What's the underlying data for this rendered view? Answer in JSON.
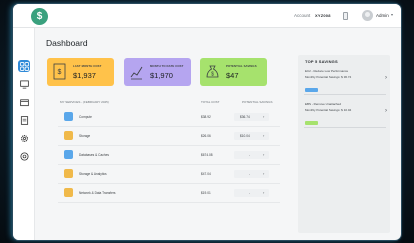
{
  "header": {
    "logo_text": "$",
    "account_label": "Account",
    "account_value": "XYZ008",
    "user_name": "Admin",
    "user_caret": "▾"
  },
  "sidebar": {
    "items": [
      {
        "icon": "grid-icon",
        "active": true
      },
      {
        "icon": "monitor-icon",
        "active": false
      },
      {
        "icon": "wallet-icon",
        "active": false
      },
      {
        "icon": "document-icon",
        "active": false
      },
      {
        "icon": "gear-icon",
        "active": false
      },
      {
        "icon": "globe-icon",
        "active": false
      }
    ]
  },
  "page": {
    "title": "Dashboard"
  },
  "cards": [
    {
      "label": "LAST MONTH COST",
      "value": "$1,937",
      "color": "#ffc24a"
    },
    {
      "label": "MONTH TO DATE COST",
      "value": "$1,970",
      "color": "#b5a5f0"
    },
    {
      "label": "POTENTIAL SAVINGS",
      "value": "$47",
      "color": "#a6e26d"
    }
  ],
  "services": {
    "header_name": "MY SERVICES - (FEBRUARY 2025)",
    "header_cost": "TOTAL COST",
    "header_savings": "POTENTIAL SAVINGS",
    "rows": [
      {
        "name": "Compute",
        "cost": "$38.92",
        "savings": "$36.74",
        "color": "#5aa7ea"
      },
      {
        "name": "Storage",
        "cost": "$26.06",
        "savings": "$10.04",
        "color": "#f0b94a"
      },
      {
        "name": "Databases & Caches",
        "cost": "$674.08",
        "savings": "-",
        "color": "#5aa7ea"
      },
      {
        "name": "Storage & Analytics",
        "cost": "$47.04",
        "savings": "-",
        "color": "#f0b94a"
      },
      {
        "name": "Network & Data Transfers",
        "cost": "$19.01",
        "savings": "-",
        "color": "#f0b94a"
      }
    ]
  },
  "top_savings": {
    "title": "TOP 5 SAVINGS",
    "items": [
      {
        "line1": "EC2 - Reduce Low Performance",
        "line2": "Monthly Potential Savings: $ 36.74",
        "badge_color": "#5aa7ea"
      },
      {
        "line1": "EBS - Remove Unattached",
        "line2": "Monthly Potential Savings: $ 10.04",
        "badge_color": "#a6e26d"
      }
    ]
  },
  "colors": {
    "accent": "#2f8ad8",
    "brand": "#3aa17e"
  }
}
